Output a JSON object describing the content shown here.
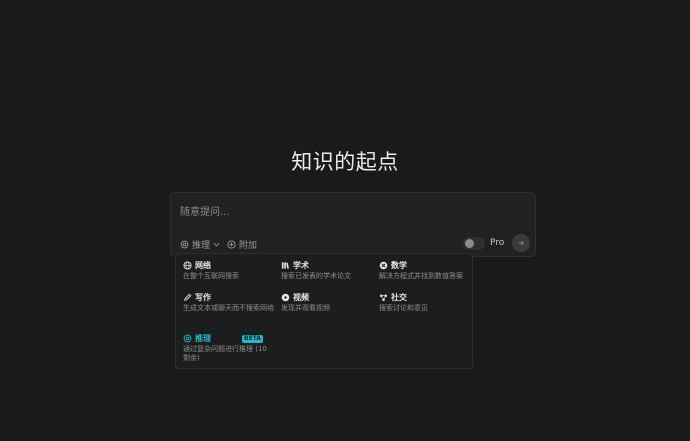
{
  "headline": "知识的起点",
  "search": {
    "placeholder": "随意提问...",
    "focus_label": "推理",
    "attach_label": "附加",
    "pro_label": "Pro"
  },
  "focus_options": [
    {
      "title": "网络",
      "desc": "在整个互联网搜索",
      "icon": "globe-icon"
    },
    {
      "title": "学术",
      "desc": "搜索已发表的学术论文",
      "icon": "books-icon"
    },
    {
      "title": "数学",
      "desc": "解决方程式并找到数值答案",
      "icon": "math-icon"
    },
    {
      "title": "写作",
      "desc": "生成文本或聊天而不搜索网络",
      "icon": "pencil-icon"
    },
    {
      "title": "视频",
      "desc": "发现并观看视频",
      "icon": "play-icon"
    },
    {
      "title": "社交",
      "desc": "搜索讨论和意见",
      "icon": "social-icon"
    },
    {
      "title": "推理",
      "desc": "通过复杂问题进行推理 (10 剩余)",
      "icon": "reasoning-icon",
      "badge": "BETA"
    }
  ],
  "colors": {
    "background": "#191a1a",
    "accent": "#20b8cd"
  }
}
